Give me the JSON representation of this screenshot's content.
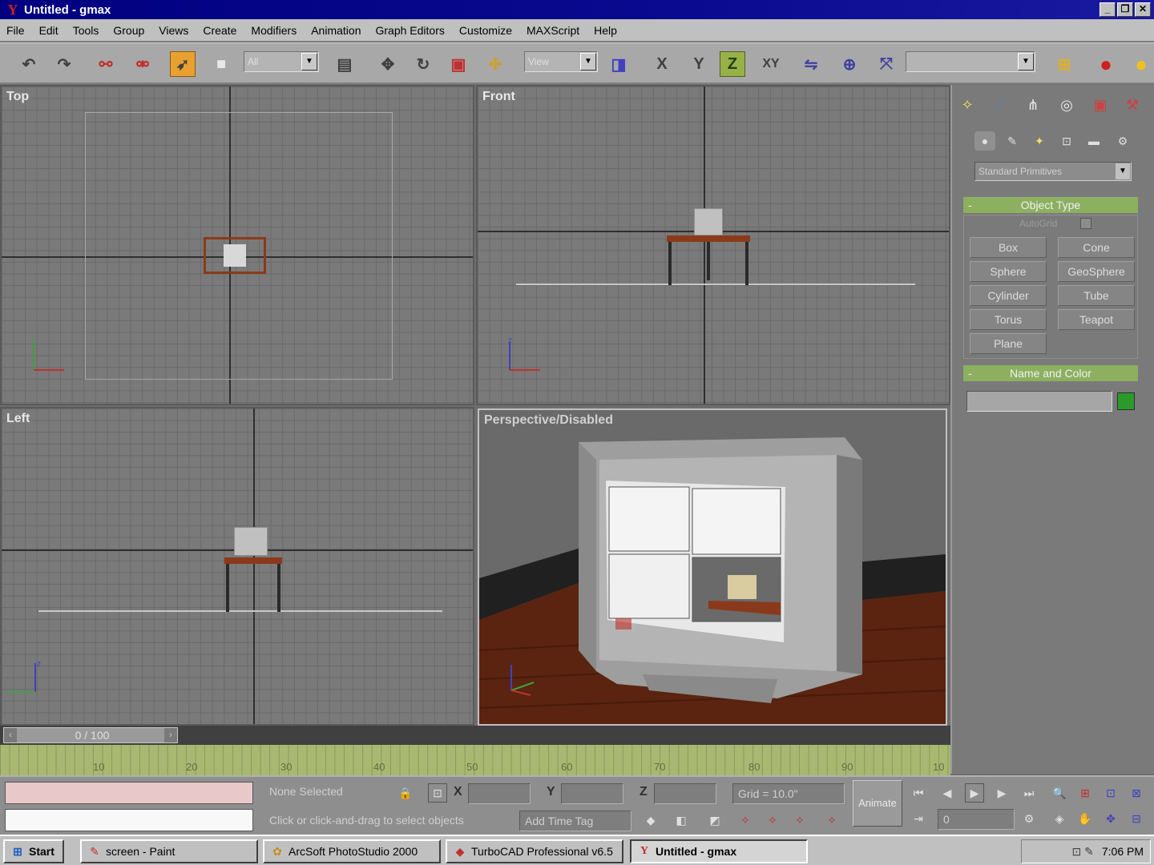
{
  "window": {
    "title": "Untitled - gmax",
    "app_icon": "gmax-logo-icon"
  },
  "menu": [
    "File",
    "Edit",
    "Tools",
    "Group",
    "Views",
    "Create",
    "Modifiers",
    "Animation",
    "Graph Editors",
    "Customize",
    "MAXScript",
    "Help"
  ],
  "toolbar": {
    "selection_filter": "All",
    "reference_coord": "View",
    "axis_z": "Z",
    "axis_x": "X",
    "axis_y": "Y",
    "axis_xy": "XY",
    "named_selection": ""
  },
  "viewports": {
    "top": "Top",
    "front": "Front",
    "left": "Left",
    "perspective": "Perspective/Disabled"
  },
  "command_panel": {
    "category": "Standard Primitives",
    "object_type_header": "Object Type",
    "autogrid": "AutoGrid",
    "primitives": [
      "Box",
      "Cone",
      "Sphere",
      "GeoSphere",
      "Cylinder",
      "Tube",
      "Torus",
      "Teapot",
      "Plane"
    ],
    "name_color_header": "Name and Color",
    "name_value": "",
    "color": "#2a9a2a"
  },
  "timeline": {
    "slider_label": "0 / 100",
    "ticks": [
      "10",
      "20",
      "30",
      "40",
      "50",
      "60",
      "70",
      "80",
      "90",
      "10"
    ]
  },
  "status": {
    "selection": "None Selected",
    "prompt": "Click or click-and-drag to select objects",
    "x_label": "X",
    "y_label": "Y",
    "z_label": "Z",
    "x_value": "",
    "y_value": "",
    "z_value": "",
    "grid": "Grid = 10.0\"",
    "add_time_tag": "Add Time Tag",
    "animate": "Animate",
    "frame": "0"
  },
  "taskbar": {
    "start": "Start",
    "tasks": [
      "screen - Paint",
      "ArcSoft PhotoStudio 2000",
      "TurboCAD Professional v6.5",
      "Untitled - gmax"
    ],
    "clock": "7:06 PM"
  }
}
